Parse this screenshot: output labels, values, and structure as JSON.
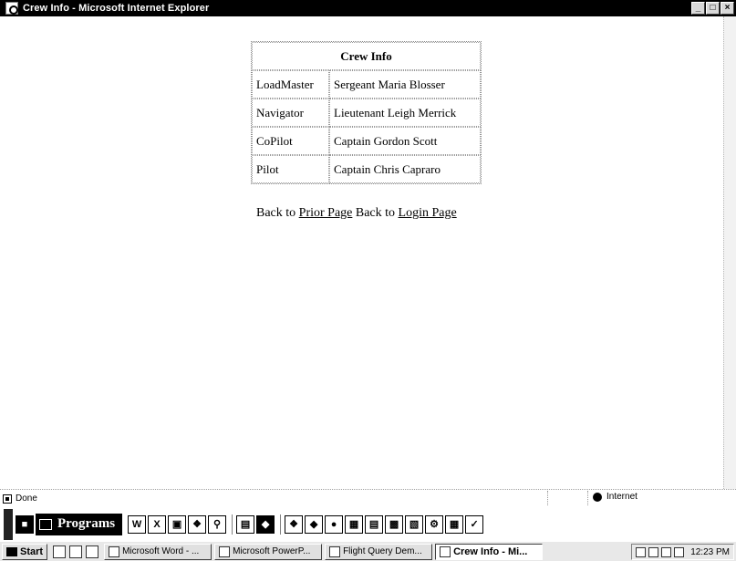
{
  "window": {
    "title": "Crew Info - Microsoft Internet Explorer",
    "min": "_",
    "max": "□",
    "close": "×"
  },
  "crew_table": {
    "header": "Crew Info",
    "rows": [
      {
        "role": "LoadMaster",
        "name": "Sergeant Maria Blosser"
      },
      {
        "role": "Navigator",
        "name": "Lieutenant Leigh Merrick"
      },
      {
        "role": "CoPilot",
        "name": "Captain Gordon Scott"
      },
      {
        "role": "Pilot",
        "name": "Captain Chris Capraro"
      }
    ]
  },
  "links": {
    "back_to_1": "Back to",
    "prior_page": "Prior Page",
    "back_to_2": "Back to",
    "login_page": "Login Page"
  },
  "status": {
    "text": "Done",
    "zone": "Internet"
  },
  "office_bar": {
    "programs_label": "Programs"
  },
  "taskbar": {
    "start": "Start",
    "tasks": [
      "Microsoft Word - ...",
      "Microsoft PowerP...",
      "Flight Query Dem...",
      "Crew Info - Mi..."
    ],
    "clock": "12:23 PM"
  }
}
